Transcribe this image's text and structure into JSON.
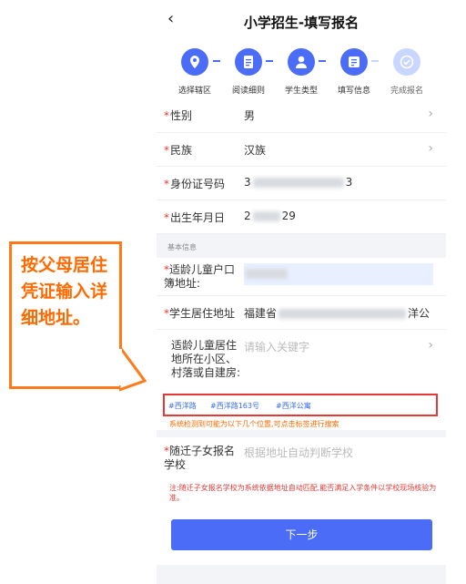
{
  "nav": {
    "back": "‹",
    "title": "小学招生-填写报名"
  },
  "steps": [
    {
      "label": "选择辖区",
      "icon": "location-pin-icon"
    },
    {
      "label": "阅读细则",
      "icon": "document-icon"
    },
    {
      "label": "学生类型",
      "icon": "user-icon"
    },
    {
      "label": "填写信息",
      "icon": "form-icon"
    },
    {
      "label": "完成报名",
      "icon": "check-icon"
    }
  ],
  "form": {
    "gender": {
      "label": "性别",
      "value": "男"
    },
    "ethnicity": {
      "label": "民族",
      "value": "汉族"
    },
    "id_number": {
      "label": "身份证号码",
      "value_start": "3",
      "value_end": "3"
    },
    "birthdate": {
      "label": "出生年月日",
      "value_start": "2",
      "value_end": "29"
    }
  },
  "section_title": "基本信息",
  "household_address": {
    "label": "适龄儿童户口簿地址:"
  },
  "residence_address": {
    "label": "学生居住地址",
    "value_start": "福建省",
    "value_end": "洋公"
  },
  "community": {
    "label": "适龄儿童居住地所在小区、村落或自建房:",
    "placeholder": "请输入关键字"
  },
  "suggestions": {
    "tags": [
      "#西洋路",
      "#西洋路163号",
      "#西洋公寓"
    ],
    "hint": "系统检测到可能为以下几个位置,可点击标签进行搜索"
  },
  "school": {
    "label": "随迁子女报名学校",
    "placeholder": "根据地址自动判断学校"
  },
  "note": "注:随迁子女报名学校为系统依据地址自动匹配,能否满足入学条件以学校现场核验为准。",
  "next_button": "下一步",
  "callout": "按父母居住凭证输入详细地址。",
  "colors": {
    "primary": "#4a6cf7",
    "required": "#e53935",
    "callout": "#ff6a00"
  }
}
